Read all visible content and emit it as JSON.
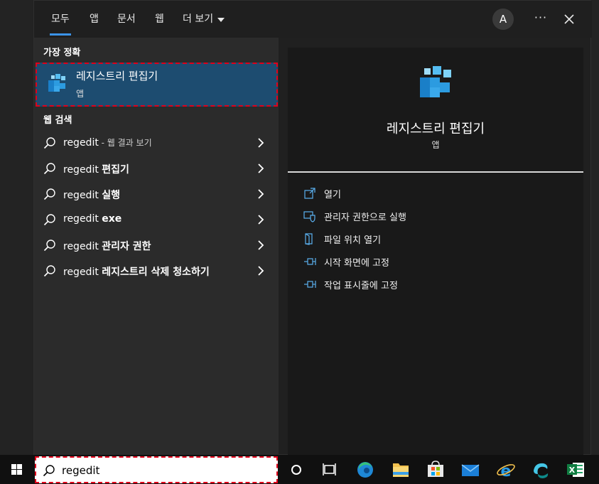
{
  "tabs": [
    {
      "label": "모두",
      "active": true
    },
    {
      "label": "앱"
    },
    {
      "label": "문서"
    },
    {
      "label": "웹"
    },
    {
      "label": "더 보기"
    }
  ],
  "header": {
    "avatar_initial": "A",
    "more_label": "···"
  },
  "best_match": {
    "heading": "가장 정확",
    "title": "레지스트리 편집기",
    "subtitle": "앱",
    "icon": "registry-editor-icon"
  },
  "web_search": {
    "heading": "웹 검색",
    "items": [
      {
        "query": "regedit",
        "suffix": " - 웹 결과 보기",
        "bold": ""
      },
      {
        "query": "regedit ",
        "suffix": "",
        "bold": "편집기"
      },
      {
        "query": "regedit ",
        "suffix": "",
        "bold": "실행"
      },
      {
        "query": "regedit ",
        "suffix": "",
        "bold": "exe"
      },
      {
        "query": "regedit ",
        "suffix": "",
        "bold": "관리자 권한"
      },
      {
        "query": "regedit ",
        "suffix": "",
        "bold": "레지스트리 삭제 청소하기"
      }
    ]
  },
  "detail": {
    "title": "레지스트리 편집기",
    "subtitle": "앱",
    "actions": [
      {
        "label": "열기",
        "icon": "open-icon"
      },
      {
        "label": "관리자 권한으로 실행",
        "icon": "shield-run-icon"
      },
      {
        "label": "파일 위치 열기",
        "icon": "file-location-icon"
      },
      {
        "label": "시작 화면에 고정",
        "icon": "pin-icon"
      },
      {
        "label": "작업 표시줄에 고정",
        "icon": "pin-icon"
      }
    ]
  },
  "search": {
    "value": "regedit"
  },
  "taskbar": {
    "icons": [
      "windows-start-icon",
      "cortana-icon",
      "task-view-icon",
      "edge-icon",
      "file-explorer-icon",
      "store-icon",
      "mail-icon",
      "internet-explorer-icon",
      "app-icon",
      "excel-icon"
    ]
  },
  "colors": {
    "accent": "#3b93e8",
    "selection": "#1d4c70",
    "highlight_border": "#e0001b"
  }
}
